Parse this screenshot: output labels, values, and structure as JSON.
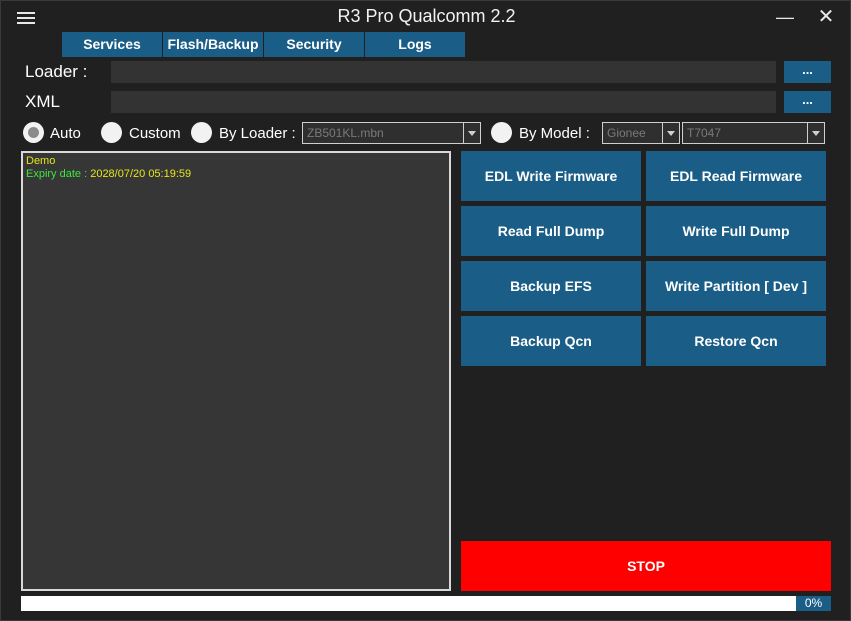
{
  "window": {
    "title": "R3 Pro Qualcomm 2.2",
    "minimize_glyph": "—",
    "close_glyph": "✕"
  },
  "tabs": [
    {
      "label": "Services"
    },
    {
      "label": "Flash/Backup"
    },
    {
      "label": "Security"
    },
    {
      "label": "Logs"
    }
  ],
  "loader": {
    "label": "Loader :",
    "value": "",
    "browse_label": "..."
  },
  "xml": {
    "label": "XML",
    "value": "",
    "browse_label": "..."
  },
  "mode": {
    "auto_label": "Auto",
    "custom_label": "Custom",
    "by_loader_label": "By Loader :",
    "by_loader_value": "ZB501KL.mbn",
    "by_model_label": "By Model :",
    "brand_value": "Gionee",
    "model_value": "T7047",
    "selected": "auto"
  },
  "log": {
    "line1": "Demo",
    "expiry_key": "Expiry date : ",
    "expiry_value": "2028/07/20 05:19:59"
  },
  "actions": {
    "edl_write": "EDL Write Firmware",
    "edl_read": "EDL Read Firmware",
    "read_dump": "Read Full Dump",
    "write_dump": "Write Full Dump",
    "backup_efs": "Backup EFS",
    "write_partition": "Write Partition [ Dev ]",
    "backup_qcn": "Backup Qcn",
    "restore_qcn": "Restore Qcn",
    "stop": "STOP"
  },
  "progress": {
    "percent_label": "0%",
    "value": 0
  },
  "colors": {
    "accent": "#1a5d86",
    "stop": "#ff0000",
    "background": "#202020",
    "log_yellow": "#e6e61a",
    "log_green": "#3ee63e"
  }
}
